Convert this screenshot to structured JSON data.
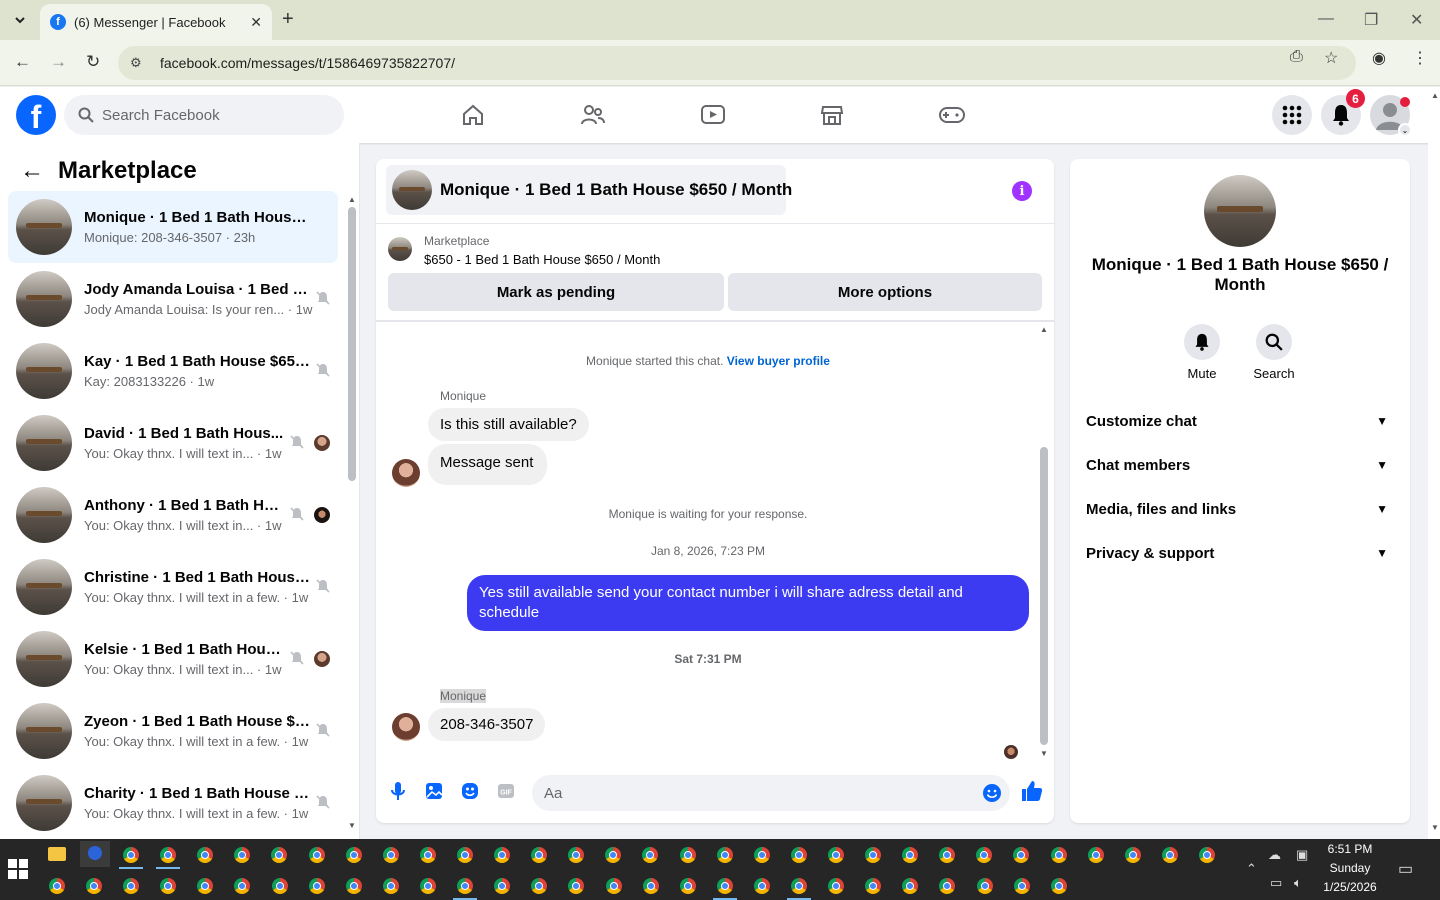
{
  "browser": {
    "tab_title": "(6) Messenger | Facebook",
    "url": "facebook.com/messages/t/1586469735822707/"
  },
  "fb": {
    "search_placeholder": "Search Facebook",
    "notif_count": "6"
  },
  "left": {
    "title": "Marketplace",
    "conversations": [
      {
        "name": "Monique · 1 Bed 1 Bath House $...",
        "sub": "Monique: 208-346-3507 · 23h"
      },
      {
        "name": "Jody Amanda Louisa · 1 Bed 1 ...",
        "sub": "Jody Amanda Louisa: Is your ren... · 1w"
      },
      {
        "name": "Kay · 1 Bed 1 Bath House $650...",
        "sub": "Kay: 2083133226 · 1w"
      },
      {
        "name": "David · 1 Bed 1 Bath Hous...",
        "sub": "You: Okay thnx. I will text in... · 1w"
      },
      {
        "name": "Anthony · 1 Bed 1 Bath Ho...",
        "sub": "You: Okay thnx. I will text in... · 1w"
      },
      {
        "name": "Christine · 1 Bed 1 Bath House...",
        "sub": "You: Okay thnx. I will text in a few. · 1w"
      },
      {
        "name": "Kelsie · 1 Bed 1 Bath Hous...",
        "sub": "You: Okay thnx. I will text in... · 1w"
      },
      {
        "name": "Zyeon · 1 Bed 1 Bath House $6...",
        "sub": "You: Okay thnx. I will text in a few. · 1w"
      },
      {
        "name": "Charity · 1 Bed 1 Bath House $...",
        "sub": "You: Okay thnx. I will text in a few. · 1w"
      }
    ]
  },
  "chat": {
    "title": "Monique · 1 Bed 1 Bath House $650 / Month",
    "marketplace_label": "Marketplace",
    "listing": "$650 - 1 Bed 1 Bath House $650 / Month",
    "btn_pending": "Mark as pending",
    "btn_more": "More options",
    "started": "Monique started this chat.",
    "view_profile": "View buyer profile",
    "sender1": "Monique",
    "msg1": "Is this still available?",
    "msg2": "Message sent",
    "waiting": "Monique is waiting for your response.",
    "date1": "Jan 8, 2026, 7:23 PM",
    "out_msg": "Yes still available send your contact number i will share adress detail and schedule",
    "date2": "Sat 7:31 PM",
    "sender2": "Monique",
    "msg3": "208-346-3507",
    "composer_placeholder": "Aa"
  },
  "right": {
    "name": "Monique · 1 Bed 1 Bath House $650 / Month",
    "mute": "Mute",
    "search": "Search",
    "items": [
      "Customize chat",
      "Chat members",
      "Media, files and links",
      "Privacy & support"
    ]
  },
  "taskbar": {
    "time": "6:51 PM",
    "day": "Sunday",
    "date": "1/25/2026"
  },
  "colors": {
    "fb_blue": "#0866ff",
    "outgoing_bubble": "#3d3bf2",
    "info_purple": "#a033ff",
    "badge_red": "#e41e3f"
  }
}
